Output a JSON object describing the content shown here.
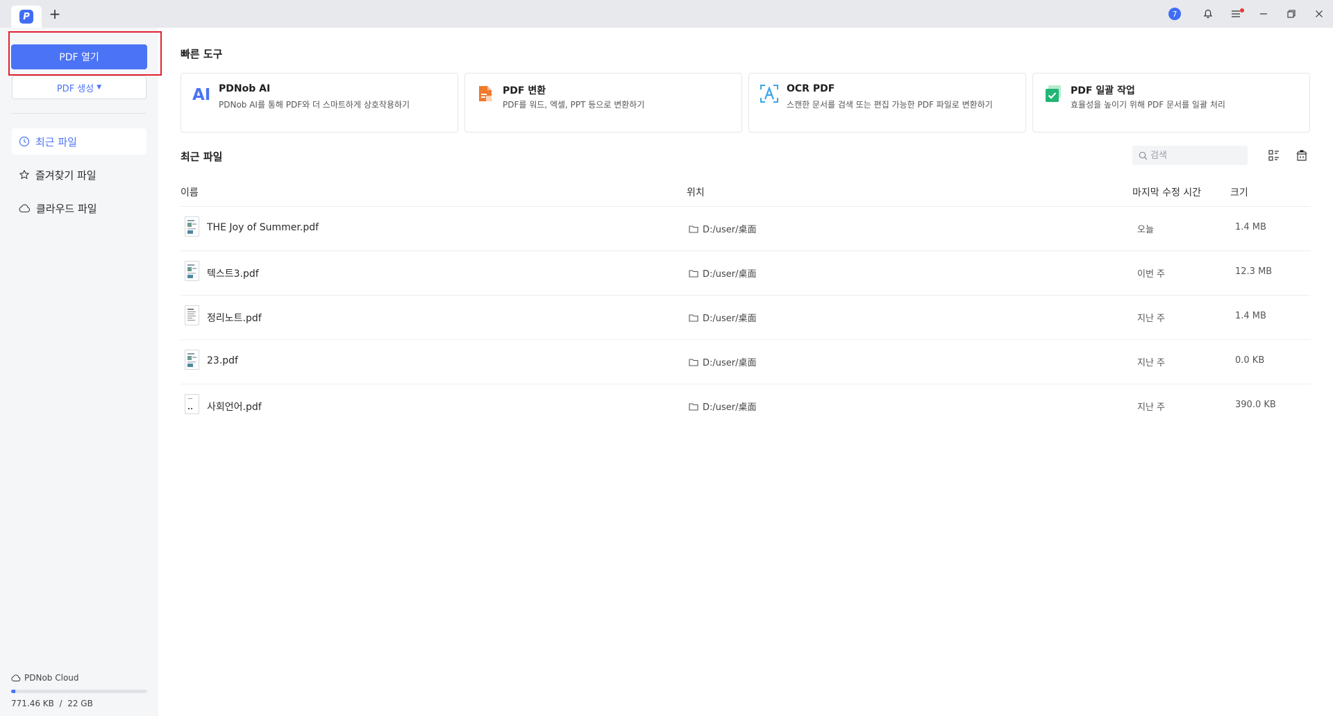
{
  "titlebar": {
    "notification_count": "7",
    "new_tab_label": "+"
  },
  "sidebar": {
    "open_pdf_label": "PDF 열기",
    "create_pdf_label": "PDF 생성",
    "nav_items": [
      {
        "label": "최근 파일",
        "icon": "clock-icon",
        "active": true
      },
      {
        "label": "즐겨찾기 파일",
        "icon": "star-icon",
        "active": false
      },
      {
        "label": "클라우드 파일",
        "icon": "cloud-icon",
        "active": false
      }
    ],
    "cloud": {
      "label": "PDNob Cloud",
      "usage": "771.46 KB  /  22 GB",
      "used_fraction": 0.03
    }
  },
  "quick_tools": {
    "title": "빠른 도구",
    "cards": [
      {
        "title": "PDNob AI",
        "desc": "PDNob AI를 통해 PDF와 더 스마트하게 상호작용하기",
        "icon": "ai-icon"
      },
      {
        "title": "PDF 변환",
        "desc": "PDF를 워드, 엑셀, PPT 등으로 변환하기",
        "icon": "convert-icon"
      },
      {
        "title": "OCR PDF",
        "desc": "스캔한 문서를 검색 또는 편집 가능한 PDF 파일로 변환하기",
        "icon": "ocr-icon"
      },
      {
        "title": "PDF 일괄 작업",
        "desc": "효율성을 높이기 위해 PDF 문서를 일괄 처리",
        "icon": "batch-icon"
      }
    ]
  },
  "recent": {
    "title": "최근 파일",
    "search_placeholder": "검색",
    "columns": {
      "name": "이름",
      "location": "위치",
      "modified": "마지막 수정 시간",
      "size": "크기"
    },
    "files": [
      {
        "name": "THE Joy of Summer.pdf",
        "location": "D:/user/桌面",
        "modified": "오늘",
        "size": "1.4 MB"
      },
      {
        "name": "텍스트3.pdf",
        "location": "D:/user/桌面",
        "modified": "이번 주",
        "size": "12.3 MB"
      },
      {
        "name": "정리노트.pdf",
        "location": "D:/user/桌面",
        "modified": "지난 주",
        "size": "1.4 MB"
      },
      {
        "name": "23.pdf",
        "location": "D:/user/桌面",
        "modified": "지난 주",
        "size": "0.0 KB"
      },
      {
        "name": "사회언어.pdf",
        "location": "D:/user/桌面",
        "modified": "지난 주",
        "size": "390.0 KB"
      }
    ]
  },
  "colors": {
    "accent": "#4b73f5",
    "highlight_border": "#e2212f"
  }
}
